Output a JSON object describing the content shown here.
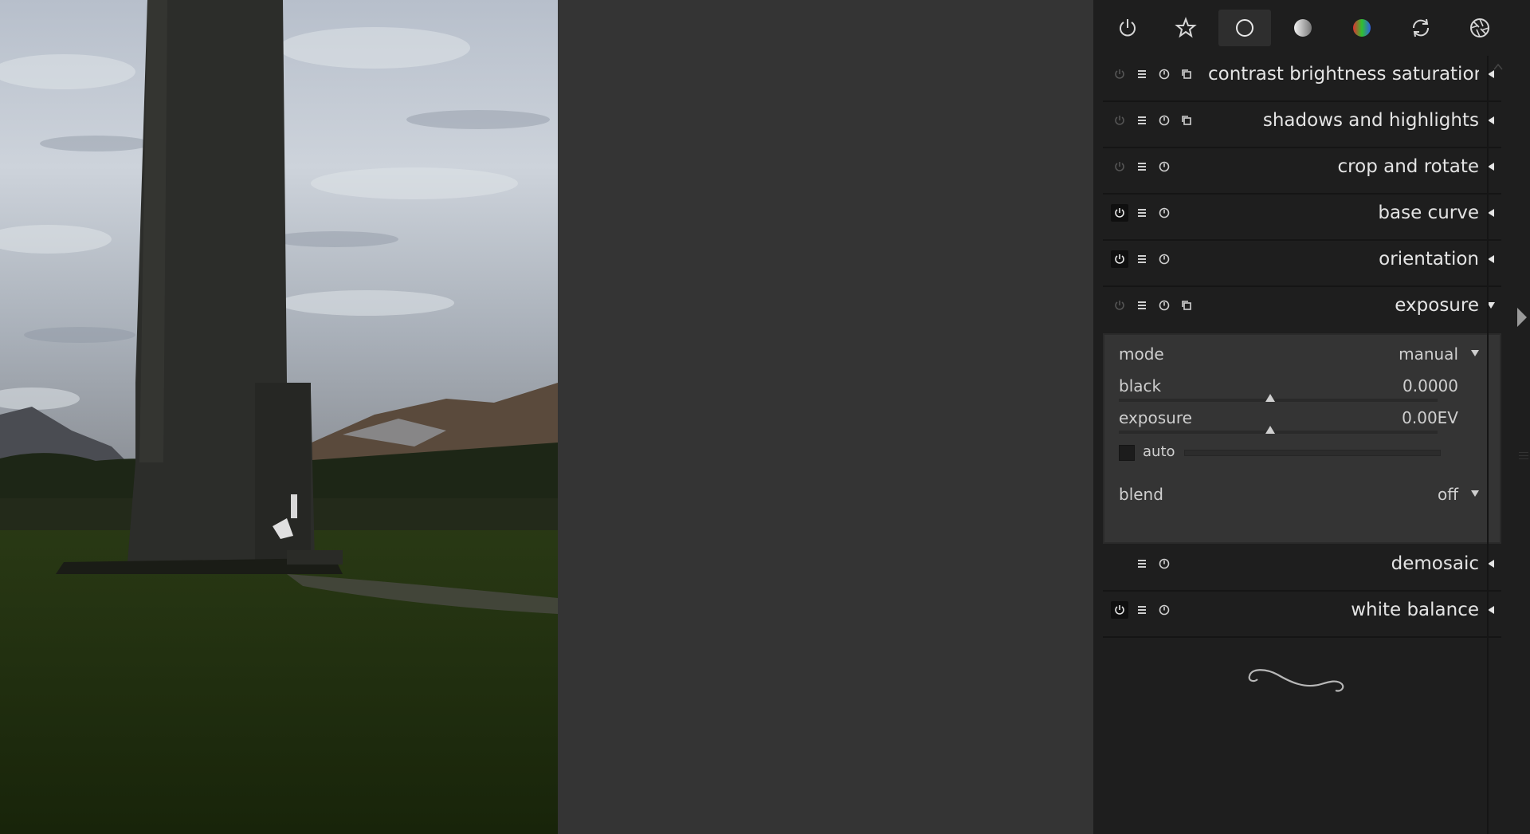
{
  "module_tabs": [
    {
      "icon": "power-icon",
      "active": false
    },
    {
      "icon": "star-icon",
      "active": false
    },
    {
      "icon": "basic-circle-icon",
      "active": true
    },
    {
      "icon": "tone-circle-icon",
      "active": false
    },
    {
      "icon": "color-circle-icon",
      "active": false
    },
    {
      "icon": "correct-rotate-icon",
      "active": false
    },
    {
      "icon": "effects-aperture-icon",
      "active": false
    }
  ],
  "modules": {
    "contrast": {
      "name": "contrast brightness saturation"
    },
    "shadows": {
      "name": "shadows and highlights"
    },
    "crop": {
      "name": "crop and rotate"
    },
    "basecurve": {
      "name": "base curve"
    },
    "orientation": {
      "name": "orientation"
    },
    "exposure": {
      "name": "exposure"
    },
    "demosaic": {
      "name": "demosaic"
    },
    "whitebalance": {
      "name": "white balance"
    }
  },
  "exposure": {
    "mode_label": "mode",
    "mode_value": "manual",
    "black_label": "black",
    "black_value": "0.0000",
    "exposure_label": "exposure",
    "exposure_value": "0.00EV",
    "auto_label": "auto",
    "blend_label": "blend",
    "blend_value": "off"
  },
  "colors": {
    "panel_bg": "#1e1e1e",
    "canvas_bg": "#343434",
    "text": "#e4e4e4"
  }
}
